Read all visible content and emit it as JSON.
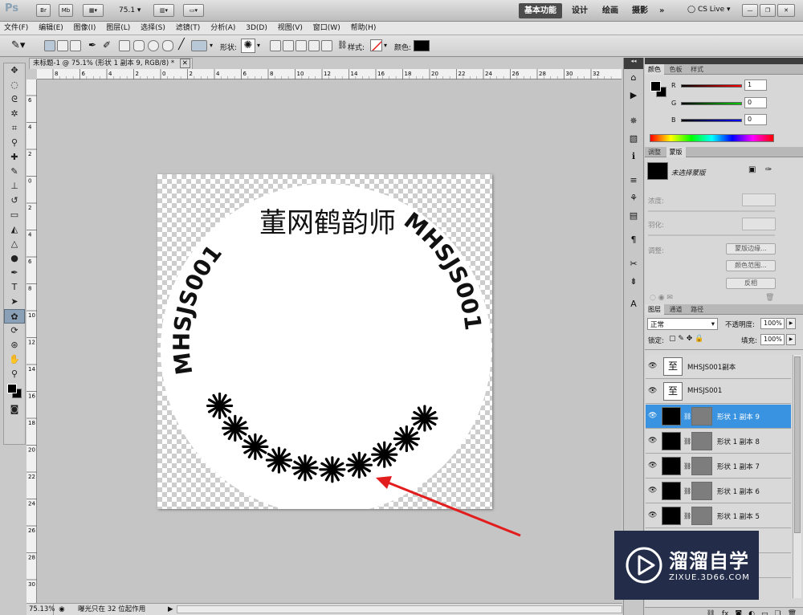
{
  "app": {
    "logo": "Ps",
    "zoom_value": "75.1",
    "workspaces": [
      "基本功能",
      "设计",
      "绘画",
      "摄影"
    ],
    "more": "»",
    "cslive": "CS Live"
  },
  "menus": [
    "文件(F)",
    "编辑(E)",
    "图像(I)",
    "图层(L)",
    "选择(S)",
    "滤镜(T)",
    "分析(A)",
    "3D(D)",
    "视图(V)",
    "窗口(W)",
    "帮助(H)"
  ],
  "options": {
    "shape_label": "形状:",
    "style_label": "样式:",
    "color_label": "颜色:",
    "shape_glyph": "✺",
    "fill_color": "#000000"
  },
  "document": {
    "tab_title": "未标题-1 @ 75.1% (形状 1 副本 9, RGB/8) *",
    "ruler_top": [
      "8",
      "6",
      "4",
      "2",
      "0",
      "2",
      "4",
      "6",
      "8",
      "10",
      "12",
      "14",
      "16",
      "18",
      "20",
      "22",
      "24",
      "26",
      "28",
      "30",
      "32"
    ],
    "ruler_left": [
      "6",
      "4",
      "2",
      "0",
      "2",
      "4",
      "6",
      "8",
      "10",
      "12",
      "14",
      "16",
      "18",
      "20",
      "22",
      "24",
      "26",
      "28",
      "30"
    ],
    "stamp_title": "董网鹤韵师",
    "stamp_code_left": "MHSJS001",
    "stamp_code_right": "MHSJS001",
    "flower_glyph": "✺"
  },
  "status": {
    "zoom": "75.13%",
    "info": "曝光只在 32 位起作用"
  },
  "color_panel": {
    "tabs": [
      "颜色",
      "色板",
      "样式"
    ],
    "channels": [
      {
        "label": "R",
        "value": "1"
      },
      {
        "label": "G",
        "value": "0"
      },
      {
        "label": "B",
        "value": "0"
      }
    ]
  },
  "adjust_panel": {
    "tabs": [
      "调整",
      "蒙版"
    ],
    "no_mask": "未选择蒙版",
    "density": "浓度:",
    "feather": "羽化:",
    "refine": "调整:",
    "buttons": [
      "蒙版边缘...",
      "颜色范围...",
      "反相"
    ]
  },
  "layers_panel": {
    "tabs": [
      "图层",
      "通道",
      "路径"
    ],
    "blend_mode": "正常",
    "opacity_label": "不透明度:",
    "opacity": "100%",
    "lock_label": "锁定:",
    "fill_label": "填充:",
    "fill": "100%",
    "layers": [
      {
        "name": "MHSJS001副本",
        "kind": "text",
        "selected": false
      },
      {
        "name": "MHSJS001",
        "kind": "text",
        "selected": false
      },
      {
        "name": "形状 1 副本 9",
        "kind": "shape",
        "selected": true
      },
      {
        "name": "形状 1 副本 8",
        "kind": "shape",
        "selected": false
      },
      {
        "name": "形状 1 副本 7",
        "kind": "shape",
        "selected": false
      },
      {
        "name": "形状 1 副本 6",
        "kind": "shape",
        "selected": false
      },
      {
        "name": "形状 1 副本 5",
        "kind": "shape",
        "selected": false
      }
    ],
    "bottom_icons": [
      "link-icon",
      "fx-icon",
      "mask-icon",
      "adjustment-icon",
      "group-icon",
      "new-layer-icon",
      "trash-icon"
    ]
  },
  "watermark": {
    "title": "溜溜自学",
    "url": "ZIXUE.3D66.COM"
  },
  "colors": {
    "accent_selection": "#3a93e0",
    "annotation_arrow": "#e21d1d",
    "watermark_bg": "#232d4a"
  }
}
